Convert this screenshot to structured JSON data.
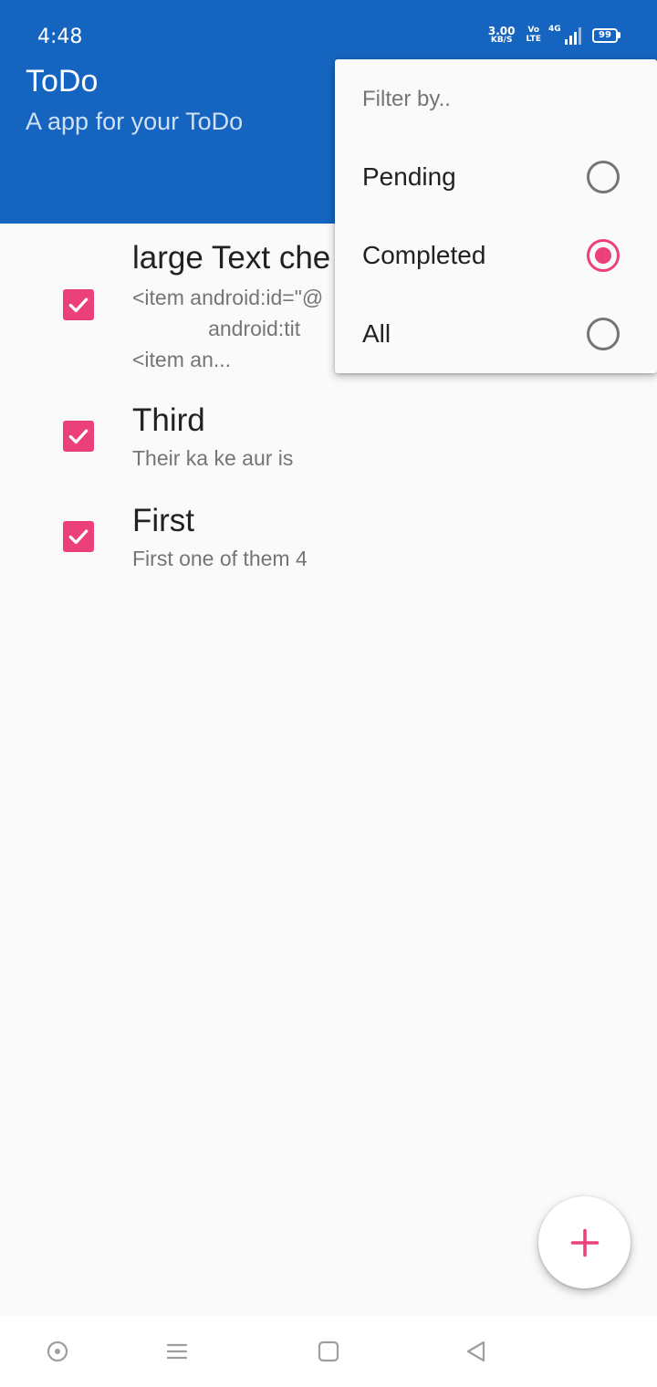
{
  "status_bar": {
    "time": "4:48",
    "net_speed_value": "3.00",
    "net_speed_unit": "KB/S",
    "volte_top": "Vo",
    "volte_bottom": "LTE",
    "network_type": "4G",
    "battery_level": "99"
  },
  "toolbar": {
    "title": "ToDo",
    "subtitle": "A app for your ToDo"
  },
  "todos": [
    {
      "title": "large Text che",
      "description": "<item android:id=\"@\n             android:tit\n<item an...",
      "checked": true
    },
    {
      "title": "Third",
      "description": "Their ka ke aur is",
      "checked": true
    },
    {
      "title": "First",
      "description": "First one of them 4",
      "checked": true
    }
  ],
  "filter_menu": {
    "header": "Filter by..",
    "options": [
      {
        "label": "Pending",
        "selected": false
      },
      {
        "label": "Completed",
        "selected": true
      },
      {
        "label": "All",
        "selected": false
      }
    ]
  },
  "fab": {
    "icon": "plus-icon"
  },
  "nav_bar": {
    "icons": [
      "assistant-icon",
      "recents-menu-icon",
      "home-square-icon",
      "back-triangle-icon"
    ]
  },
  "colors": {
    "primary": "#1565c0",
    "accent": "#ec407a",
    "background": "#fafafa"
  }
}
